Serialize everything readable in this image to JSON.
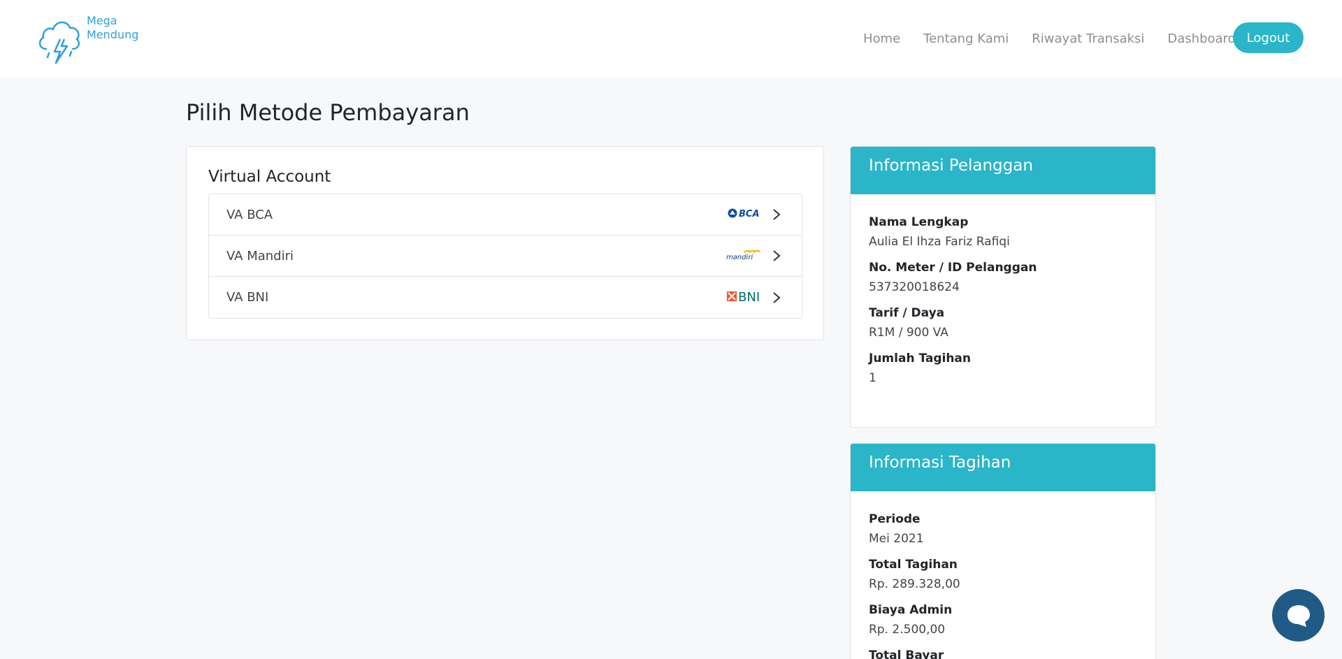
{
  "brand": {
    "line1": "Mega",
    "line2": "Mendung"
  },
  "nav": {
    "items": [
      {
        "label": "Home"
      },
      {
        "label": "Tentang Kami"
      },
      {
        "label": "Riwayat Transaksi"
      },
      {
        "label": "Dashboard"
      }
    ],
    "logout_label": "Logout"
  },
  "page_title": "Pilih Metode Pembayaran",
  "payment": {
    "section_title": "Virtual Account",
    "methods": [
      {
        "label": "VA BCA",
        "logo_text": "BCA",
        "icon": "bca-logo"
      },
      {
        "label": "VA Mandiri",
        "logo_text": "mandiri",
        "icon": "mandiri-logo"
      },
      {
        "label": "VA BNI",
        "logo_text": "BNI",
        "icon": "bni-logo"
      }
    ]
  },
  "customer_info": {
    "title": "Informasi Pelanggan",
    "rows": [
      {
        "label": "Nama Lengkap",
        "value": "Aulia El Ihza Fariz Rafiqi"
      },
      {
        "label": "No. Meter / ID Pelanggan",
        "value": "537320018624"
      },
      {
        "label": "Tarif / Daya",
        "value": "R1M / 900 VA"
      },
      {
        "label": "Jumlah Tagihan",
        "value": "1"
      }
    ]
  },
  "bill_info": {
    "title": "Informasi Tagihan",
    "rows": [
      {
        "label": "Periode",
        "value": "Mei 2021"
      },
      {
        "label": "Total Tagihan",
        "value": "Rp. 289.328,00"
      },
      {
        "label": "Biaya Admin",
        "value": "Rp. 2.500,00"
      },
      {
        "label": "Total Bayar",
        "value": ""
      }
    ]
  },
  "colors": {
    "accent": "#2ab5c9",
    "brand": "#2f9fe0",
    "chat": "#1f5b86"
  }
}
